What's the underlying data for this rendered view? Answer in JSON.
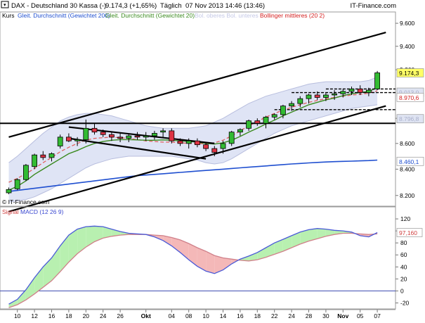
{
  "header": {
    "symbol": "DAX - Deutschland 30 Kassa (-)",
    "price": "9.174,3 (+1,65%)",
    "interval": "Täglich",
    "timestamp": "07 Nov 2013 14:46 (13:46)",
    "brand": "IT-Finance.com"
  },
  "legend": {
    "items": [
      {
        "label": "Kurs",
        "color": "#000000"
      },
      {
        "label": "Gleit. Durchschnitt (Gewichtet 200)",
        "color": "#1f4fd0"
      },
      {
        "label": "Gleit. Durchschnitt (Gewichtet 20)",
        "color": "#3a8a1e"
      },
      {
        "label": "Bol. oberes Bol. unteres",
        "color": "#c4c8e6"
      },
      {
        "label": "Bollinger mittleres (20 2)",
        "color": "#d42020"
      }
    ]
  },
  "copyright": "© IT-Finance.com",
  "price_axis": {
    "ticks": [
      "9.600",
      "9.400",
      "9.200",
      "8.800",
      "8.600",
      "8.400",
      "8.200"
    ],
    "badges": [
      {
        "text": "9.174,3",
        "bg": "#ffff66",
        "fg": "#000000",
        "value": 9174.3
      },
      {
        "text": "9.013,0",
        "bg": "#dfe4f2",
        "fg": "#aab0cc",
        "value": 9013.0
      },
      {
        "text": "8.970,6",
        "bg": "#ffffff",
        "fg": "#d42020",
        "value": 8970.6
      },
      {
        "text": "8.796,8",
        "bg": "#dfe4f2",
        "fg": "#aab0cc",
        "value": 8796.8
      },
      {
        "text": "8.460,1",
        "bg": "#ffffff",
        "fg": "#1f4fd0",
        "value": 8460.1
      }
    ]
  },
  "macd": {
    "title": "Signal MACD (12 26 9)",
    "ticks": [
      "120",
      "100",
      "80",
      "60",
      "40",
      "20",
      "0",
      "-20"
    ],
    "badge": {
      "text": "97,160",
      "value": 97.16
    }
  },
  "date_axis": {
    "labels": [
      {
        "text": "10",
        "i": 1,
        "bold": false
      },
      {
        "text": "12",
        "i": 3,
        "bold": false
      },
      {
        "text": "16",
        "i": 5,
        "bold": false
      },
      {
        "text": "18",
        "i": 7,
        "bold": false
      },
      {
        "text": "20",
        "i": 9,
        "bold": false
      },
      {
        "text": "24",
        "i": 11,
        "bold": false
      },
      {
        "text": "26",
        "i": 13,
        "bold": false
      },
      {
        "text": "Okt",
        "i": 16,
        "bold": true
      },
      {
        "text": "04",
        "i": 19,
        "bold": false
      },
      {
        "text": "08",
        "i": 21,
        "bold": false
      },
      {
        "text": "10",
        "i": 23,
        "bold": false
      },
      {
        "text": "14",
        "i": 25,
        "bold": false
      },
      {
        "text": "16",
        "i": 27,
        "bold": false
      },
      {
        "text": "18",
        "i": 29,
        "bold": false
      },
      {
        "text": "22",
        "i": 31,
        "bold": false
      },
      {
        "text": "24",
        "i": 33,
        "bold": false
      },
      {
        "text": "28",
        "i": 35,
        "bold": false
      },
      {
        "text": "30",
        "i": 37,
        "bold": false
      },
      {
        "text": "Nov",
        "i": 39,
        "bold": true
      },
      {
        "text": "05",
        "i": 41,
        "bold": false
      },
      {
        "text": "07",
        "i": 43,
        "bold": false
      }
    ]
  },
  "colors": {
    "up": "#33bb33",
    "down": "#dd3344",
    "band_fill": "#dfe4f5",
    "band_line": "#b8bede",
    "ma200": "#1f4fd0",
    "ma20": "#3a8a1e",
    "boll_mid": "#e06060",
    "macd_line": "#4a5ad8",
    "signal_line": "#d0808a",
    "macd_pos_fill": "#b8f0b0",
    "macd_neg_fill": "#f4b8b8"
  },
  "chart_data": [
    {
      "type": "candlestick",
      "title": "DAX - Deutschland 30 Kassa (-)",
      "ylim": [
        8120,
        9700
      ],
      "log_scale": true,
      "candles": [
        {
          "o": 8220,
          "h": 8260,
          "l": 8210,
          "c": 8245
        },
        {
          "o": 8250,
          "h": 8330,
          "l": 8240,
          "c": 8320
        },
        {
          "o": 8320,
          "h": 8440,
          "l": 8310,
          "c": 8430
        },
        {
          "o": 8420,
          "h": 8520,
          "l": 8400,
          "c": 8510
        },
        {
          "o": 8510,
          "h": 8540,
          "l": 8470,
          "c": 8490
        },
        {
          "o": 8490,
          "h": 8530,
          "l": 8460,
          "c": 8520
        },
        {
          "o": 8580,
          "h": 8670,
          "l": 8560,
          "c": 8650
        },
        {
          "o": 8650,
          "h": 8680,
          "l": 8610,
          "c": 8620
        },
        {
          "o": 8620,
          "h": 8650,
          "l": 8580,
          "c": 8630
        },
        {
          "o": 8630,
          "h": 8790,
          "l": 8600,
          "c": 8720
        },
        {
          "o": 8720,
          "h": 8760,
          "l": 8670,
          "c": 8690
        },
        {
          "o": 8690,
          "h": 8710,
          "l": 8650,
          "c": 8670
        },
        {
          "o": 8670,
          "h": 8690,
          "l": 8620,
          "c": 8650
        },
        {
          "o": 8650,
          "h": 8680,
          "l": 8610,
          "c": 8640
        },
        {
          "o": 8640,
          "h": 8680,
          "l": 8610,
          "c": 8660
        },
        {
          "o": 8660,
          "h": 8690,
          "l": 8630,
          "c": 8650
        },
        {
          "o": 8650,
          "h": 8690,
          "l": 8620,
          "c": 8660
        },
        {
          "o": 8660,
          "h": 8700,
          "l": 8630,
          "c": 8680
        },
        {
          "o": 8690,
          "h": 8720,
          "l": 8650,
          "c": 8700
        },
        {
          "o": 8700,
          "h": 8720,
          "l": 8600,
          "c": 8620
        },
        {
          "o": 8620,
          "h": 8640,
          "l": 8580,
          "c": 8600
        },
        {
          "o": 8600,
          "h": 8640,
          "l": 8560,
          "c": 8620
        },
        {
          "o": 8620,
          "h": 8640,
          "l": 8570,
          "c": 8590
        },
        {
          "o": 8590,
          "h": 8610,
          "l": 8540,
          "c": 8560
        },
        {
          "o": 8560,
          "h": 8580,
          "l": 8500,
          "c": 8530
        },
        {
          "o": 8560,
          "h": 8620,
          "l": 8520,
          "c": 8600
        },
        {
          "o": 8600,
          "h": 8700,
          "l": 8580,
          "c": 8690
        },
        {
          "o": 8690,
          "h": 8720,
          "l": 8660,
          "c": 8710
        },
        {
          "o": 8720,
          "h": 8790,
          "l": 8700,
          "c": 8780
        },
        {
          "o": 8780,
          "h": 8800,
          "l": 8740,
          "c": 8760
        },
        {
          "o": 8760,
          "h": 8820,
          "l": 8720,
          "c": 8810
        },
        {
          "o": 8810,
          "h": 8840,
          "l": 8790,
          "c": 8830
        },
        {
          "o": 8830,
          "h": 8910,
          "l": 8800,
          "c": 8900
        },
        {
          "o": 8900,
          "h": 8940,
          "l": 8860,
          "c": 8920
        },
        {
          "o": 8920,
          "h": 8980,
          "l": 8890,
          "c": 8960
        },
        {
          "o": 8960,
          "h": 9000,
          "l": 8920,
          "c": 8990
        },
        {
          "o": 8990,
          "h": 9020,
          "l": 8950,
          "c": 8970
        },
        {
          "o": 8970,
          "h": 9010,
          "l": 8940,
          "c": 8990
        },
        {
          "o": 8990,
          "h": 9030,
          "l": 8950,
          "c": 9000
        },
        {
          "o": 9000,
          "h": 9040,
          "l": 8970,
          "c": 9020
        },
        {
          "o": 9020,
          "h": 9060,
          "l": 8990,
          "c": 9040
        },
        {
          "o": 9040,
          "h": 9070,
          "l": 8990,
          "c": 9010
        },
        {
          "o": 9010,
          "h": 9050,
          "l": 8980,
          "c": 9030
        },
        {
          "o": 9040,
          "h": 9190,
          "l": 9030,
          "c": 9174.3
        }
      ],
      "bollinger_upper": [
        8450,
        8500,
        8560,
        8620,
        8680,
        8730,
        8780,
        8810,
        8830,
        8840,
        8840,
        8830,
        8820,
        8800,
        8780,
        8760,
        8740,
        8730,
        8720,
        8720,
        8720,
        8720,
        8730,
        8740,
        8770,
        8800,
        8840,
        8880,
        8920,
        8950,
        8980,
        9000,
        9020,
        9040,
        9060,
        9080,
        9090,
        9100,
        9100,
        9100,
        9100,
        9100,
        9110,
        9140
      ],
      "bollinger_lower": [
        8150,
        8160,
        8170,
        8190,
        8220,
        8250,
        8290,
        8330,
        8370,
        8410,
        8440,
        8460,
        8480,
        8490,
        8500,
        8500,
        8500,
        8500,
        8500,
        8500,
        8490,
        8480,
        8470,
        8450,
        8440,
        8450,
        8480,
        8520,
        8560,
        8600,
        8640,
        8680,
        8710,
        8740,
        8760,
        8780,
        8800,
        8820,
        8840,
        8860,
        8880,
        8890,
        8900,
        8910
      ],
      "bollinger_mid": [
        8300,
        8330,
        8365,
        8405,
        8450,
        8490,
        8535,
        8570,
        8600,
        8625,
        8640,
        8645,
        8650,
        8645,
        8640,
        8630,
        8620,
        8615,
        8610,
        8610,
        8605,
        8600,
        8600,
        8595,
        8605,
        8625,
        8660,
        8700,
        8740,
        8775,
        8810,
        8840,
        8865,
        8890,
        8910,
        8930,
        8945,
        8960,
        8970,
        8980,
        8990,
        8995,
        9005,
        9025
      ],
      "wma20": [
        8240,
        8270,
        8310,
        8360,
        8400,
        8440,
        8480,
        8520,
        8545,
        8575,
        8600,
        8615,
        8625,
        8630,
        8630,
        8628,
        8625,
        8625,
        8628,
        8625,
        8620,
        8615,
        8610,
        8600,
        8595,
        8605,
        8625,
        8655,
        8690,
        8720,
        8755,
        8785,
        8820,
        8850,
        8880,
        8910,
        8930,
        8950,
        8965,
        8985,
        9000,
        9010,
        9020,
        9050
      ],
      "wma200": [
        8230,
        8238,
        8246,
        8254,
        8262,
        8270,
        8278,
        8286,
        8294,
        8302,
        8310,
        8318,
        8326,
        8334,
        8342,
        8350,
        8355,
        8360,
        8365,
        8370,
        8375,
        8380,
        8385,
        8390,
        8395,
        8400,
        8405,
        8410,
        8415,
        8420,
        8425,
        8430,
        8435,
        8440,
        8444,
        8448,
        8452,
        8455,
        8458,
        8460.1,
        8462,
        8464,
        8466,
        8470
      ],
      "trendlines": [
        {
          "from": [
            0,
            8650
          ],
          "to": [
            44,
            9520
          ]
        },
        {
          "from": [
            0,
            8080
          ],
          "to": [
            44,
            8900
          ]
        },
        {
          "from": [
            7,
            8730
          ],
          "to": [
            24,
            8600
          ]
        },
        {
          "from": [
            7,
            8640
          ],
          "to": [
            23,
            8480
          ]
        }
      ],
      "horizontal_lines": [
        {
          "value": 8760,
          "style": "solid"
        },
        {
          "value": 9040,
          "style": "dashed",
          "from": 37
        },
        {
          "value": 8870,
          "style": "dashed",
          "from": 31
        },
        {
          "value": 9010,
          "style": "dashed",
          "from": 33
        }
      ]
    },
    {
      "type": "line",
      "title": "Signal MACD (12 26 9)",
      "ylim": [
        -30,
        140
      ],
      "series": [
        {
          "name": "MACD",
          "values": [
            -22,
            -14,
            2,
            22,
            40,
            55,
            75,
            93,
            103,
            107,
            108,
            107,
            103,
            99,
            96,
            95,
            94,
            90,
            84,
            75,
            64,
            52,
            41,
            33,
            29,
            35,
            45,
            53,
            58,
            64,
            72,
            80,
            86,
            92,
            98,
            102,
            104,
            103,
            101,
            100,
            98,
            92,
            90,
            97.16
          ]
        },
        {
          "name": "Signal",
          "values": [
            -28,
            -23,
            -15,
            -5,
            6,
            17,
            32,
            48,
            62,
            73,
            82,
            88,
            91,
            93,
            94,
            94,
            94,
            93,
            92,
            89,
            85,
            79,
            72,
            66,
            59,
            55,
            53,
            51,
            50,
            52,
            56,
            61,
            66,
            72,
            78,
            83,
            87,
            91,
            94,
            96,
            96,
            95,
            94,
            95
          ]
        }
      ]
    }
  ]
}
